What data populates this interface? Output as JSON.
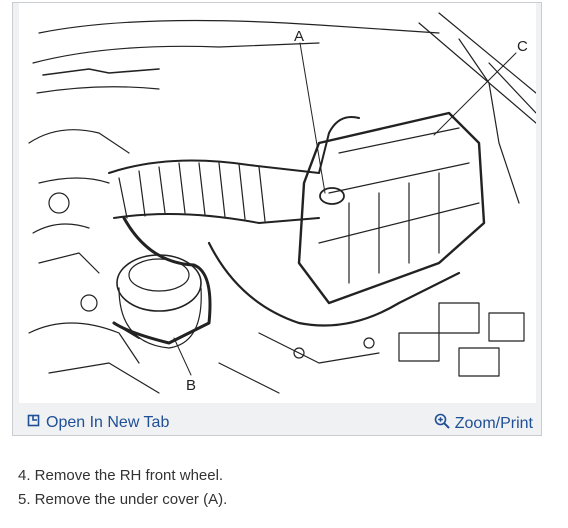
{
  "figure": {
    "callouts": {
      "a": "A",
      "b": "B",
      "c": "C"
    }
  },
  "toolbar": {
    "open_tab_label": "Open In New Tab",
    "zoom_print_label": "Zoom/Print",
    "open_tab_icon": "open-in-new-tab-icon",
    "zoom_icon": "zoom-plus-icon",
    "link_color": "#1f4f95"
  },
  "steps": [
    {
      "text": "4. Remove the RH front wheel."
    },
    {
      "text": "5. Remove the under cover (A)."
    }
  ]
}
